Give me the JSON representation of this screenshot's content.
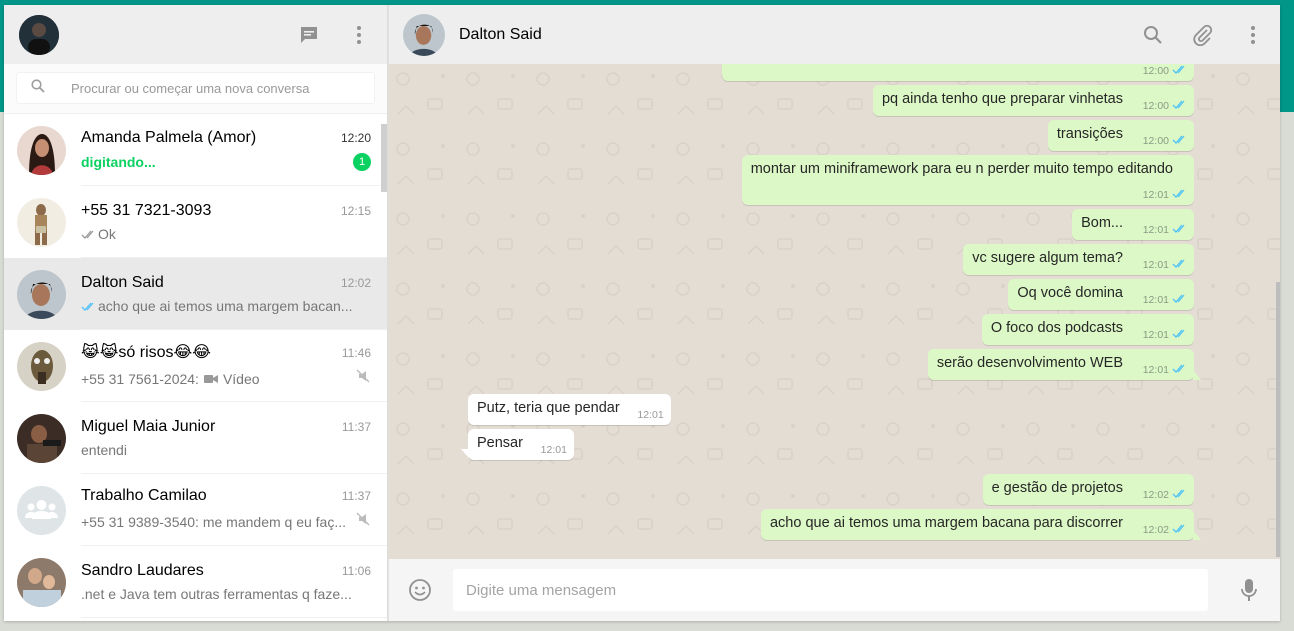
{
  "sidebar": {
    "search_placeholder": "Procurar ou começar uma nova conversa",
    "chats": [
      {
        "name": "Amanda Palmela (Amor)",
        "time": "12:20",
        "preview": "digitando...",
        "typing": true,
        "badge": "1",
        "avatar_color": "#6d3a2e"
      },
      {
        "name": "+55 31 7321-3093",
        "time": "12:15",
        "preview": "Ok",
        "ticks": "grey",
        "avatar_color": "#c2b07a"
      },
      {
        "name": "Dalton Said",
        "time": "12:02",
        "preview": "acho que ai temos uma margem bacan...",
        "ticks": "blue",
        "avatar_color": "#4e5b6a"
      },
      {
        "name": "😹😹só risos😂😂",
        "time": "11:46",
        "preview_sender": "+55 31 7561-2024:",
        "preview": "Vídeo",
        "video_icon": true,
        "muted": true,
        "avatar_color": "#8a7a5a"
      },
      {
        "name": "Miguel Maia Junior",
        "time": "11:37",
        "preview": "entendi",
        "avatar_color": "#4a3a30"
      },
      {
        "name": "Trabalho Camilao",
        "time": "11:37",
        "preview": "+55 31 9389-3540: me mandem q eu faç...",
        "muted": true,
        "group": true,
        "avatar_color": "#dfe5e7"
      },
      {
        "name": "Sandro Laudares",
        "time": "11:06",
        "preview": ".net e Java tem outras ferramentas q faze...",
        "avatar_color": "#8a6f5c"
      }
    ]
  },
  "chat": {
    "title": "Dalton Said",
    "composer_placeholder": "Digite uma mensagem",
    "messages": [
      {
        "dir": "out",
        "text": "",
        "time": "12:00"
      },
      {
        "dir": "out",
        "text": "pq ainda tenho que preparar vinhetas",
        "time": "12:00"
      },
      {
        "dir": "out",
        "text": "transições",
        "time": "12:00"
      },
      {
        "dir": "out",
        "text": "montar um miniframework para eu n perder muito tempo editando",
        "time": "12:01"
      },
      {
        "dir": "out",
        "text": "Bom...",
        "time": "12:01"
      },
      {
        "dir": "out",
        "text": "vc sugere algum tema?",
        "time": "12:01"
      },
      {
        "dir": "out",
        "text": "Oq você domina",
        "time": "12:01"
      },
      {
        "dir": "out",
        "text": "O foco dos podcasts",
        "time": "12:01"
      },
      {
        "dir": "out",
        "text": "serão desenvolvimento WEB",
        "time": "12:01"
      },
      {
        "dir": "in",
        "text": "Putz, teria que pendar",
        "time": "12:01"
      },
      {
        "dir": "in",
        "text": "Pensar",
        "time": "12:01"
      },
      {
        "dir": "out",
        "text": "e gestão de projetos",
        "time": "12:02"
      },
      {
        "dir": "out",
        "text": "acho que ai temos uma margem bacana para discorrer",
        "time": "12:02"
      }
    ]
  },
  "colors": {
    "teal_band": "#009688",
    "outgoing_bubble": "#dcf8c6",
    "read_tick": "#4fc3f7",
    "unread_green": "#09d261"
  }
}
